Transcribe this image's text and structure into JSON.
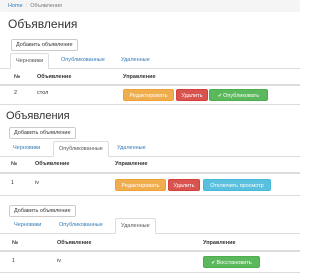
{
  "breadcrumb": {
    "home": "Home",
    "separator": "/",
    "current": "Объявления"
  },
  "sections": [
    {
      "title": "Объявления",
      "add_button": "Добавить объявление",
      "tabs": [
        "Черновики",
        "Опубликованные",
        "Удаленные"
      ],
      "active_tab": 0,
      "columns": [
        "№",
        "Объявление",
        "Управление"
      ],
      "row": {
        "number": "2",
        "name": "стол"
      },
      "actions": [
        "Редактировать",
        "Удалить",
        "Опубликовать"
      ]
    },
    {
      "title": "Объявления",
      "add_button": "Добавить объявление",
      "tabs": [
        "Черновики",
        "Опубликованные",
        "Удаленные"
      ],
      "active_tab": 1,
      "columns": [
        "№",
        "Объявление",
        "Управление"
      ],
      "row": {
        "number": "1",
        "name": "iv"
      },
      "actions": [
        "Редактировать",
        "Удалить",
        "Отключить просмотр"
      ]
    },
    {
      "add_button": "Добавить объявление",
      "tabs": [
        "Черновики",
        "Опубликованные",
        "Удаленные"
      ],
      "active_tab": 2,
      "columns": [
        "№",
        "Объявление",
        "Управление"
      ],
      "row": {
        "number": "1",
        "name": "iv"
      },
      "actions": [
        "Восстановить"
      ]
    }
  ],
  "colors": {
    "link": "#337ab7",
    "warning": "#f0ad4e",
    "danger": "#d9534f",
    "success": "#5cb85c",
    "info": "#5bc0de"
  },
  "icons": {
    "publish": "check-icon",
    "restore": "check-icon"
  }
}
